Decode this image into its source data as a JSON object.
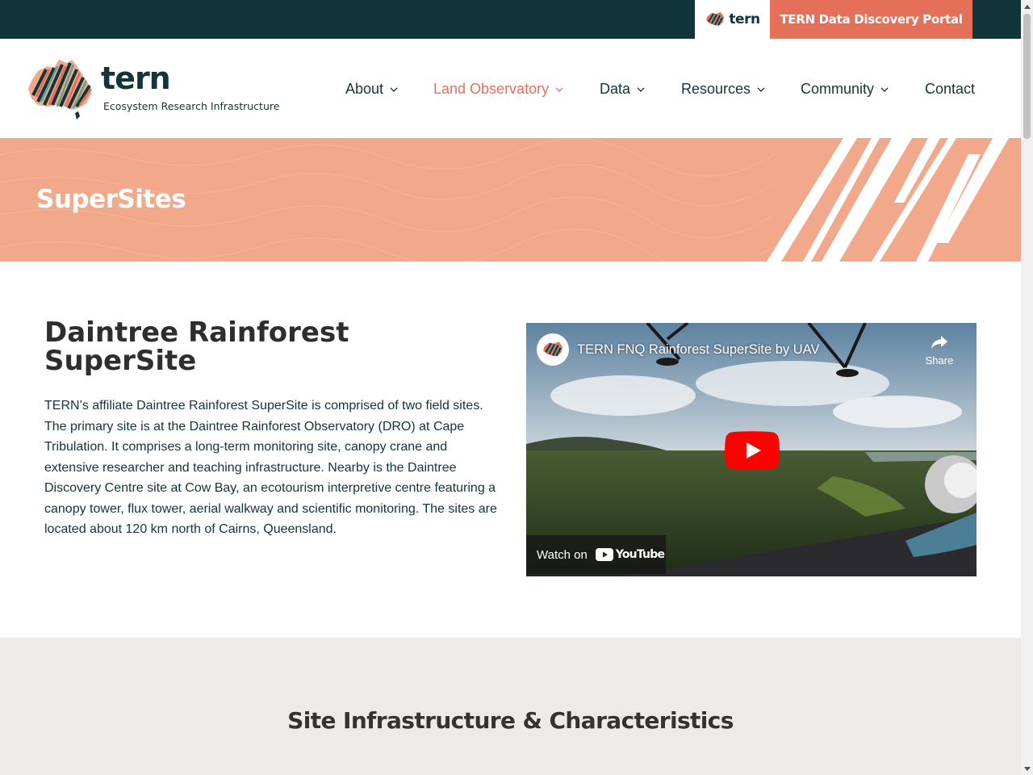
{
  "topbar": {
    "logo_text": "tern",
    "portal_label": "TERN Data Discovery Portal"
  },
  "logo": {
    "wordmark": "tern",
    "tagline": "Ecosystem Research Infrastructure"
  },
  "nav": {
    "items": [
      {
        "label": "About",
        "has_menu": true
      },
      {
        "label": "Land Observatory",
        "has_menu": true,
        "active": true
      },
      {
        "label": "Data",
        "has_menu": true
      },
      {
        "label": "Resources",
        "has_menu": true
      },
      {
        "label": "Community",
        "has_menu": true
      },
      {
        "label": "Contact",
        "has_menu": false
      }
    ]
  },
  "banner": {
    "title": "SuperSites"
  },
  "intro": {
    "title": "Daintree Rainforest SuperSite",
    "text": "TERN’s affiliate Daintree Rainforest SuperSite is comprised of two field sites.  The primary site is at the Daintree Rainforest Observatory (DRO) at Cape Tribulation. It comprises a long-term monitoring site, canopy crane and extensive researcher and teaching infrastructure. Nearby is the Daintree Discovery Centre site at Cow Bay, an ecotourism interpretive centre featuring a canopy tower, flux tower, aerial walkway and scientific monitoring. The sites are located about 120 km north of Cairns, Queensland."
  },
  "video": {
    "title": "TERN FNQ Rainforest SuperSite by UAV",
    "share_label": "Share",
    "watch_label": "Watch on",
    "youtube_label": "YouTube"
  },
  "infra": {
    "title": "Site Infrastructure & Characteristics"
  },
  "colors": {
    "dark_teal": "#12343b",
    "coral": "#e5705a",
    "banner_peach": "#f2a88a",
    "section_grey": "#edebe9"
  }
}
